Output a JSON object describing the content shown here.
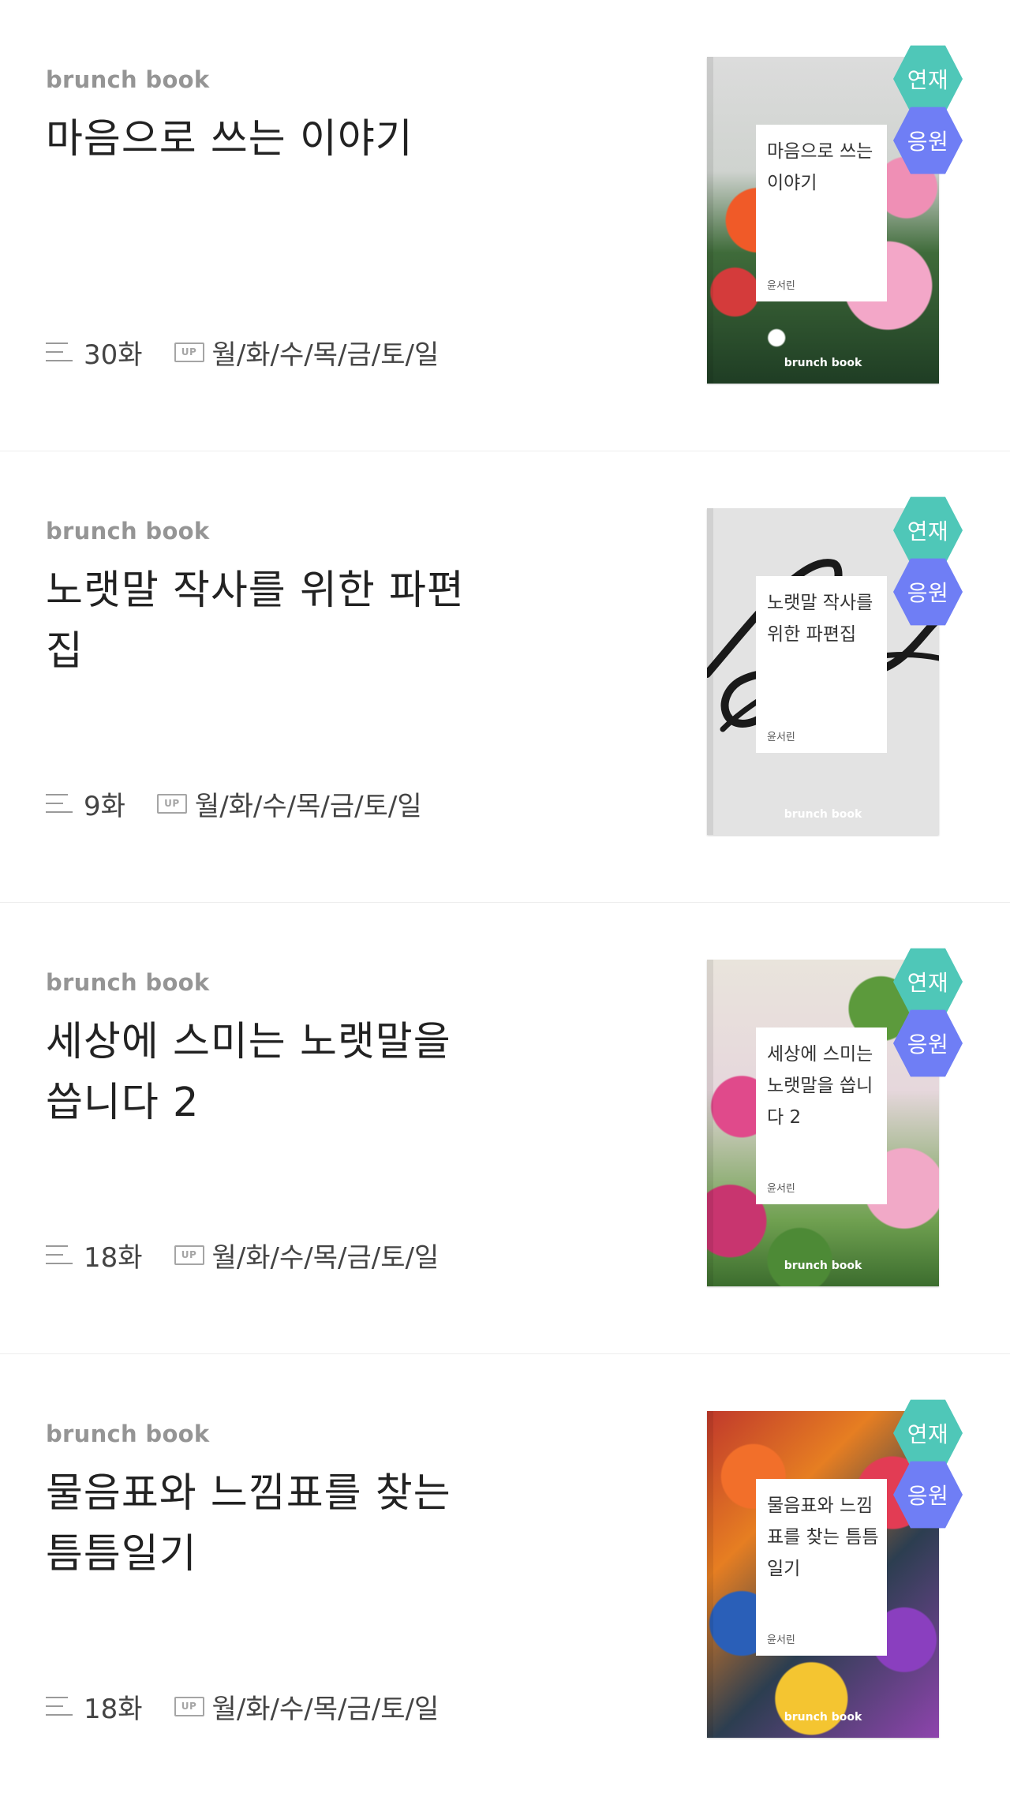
{
  "books": [
    {
      "eyebrow": "brunch book",
      "title": "마음으로 쓰는 이야기",
      "episodes": "30화",
      "up_badge": "UP",
      "schedule": "월/화/수/목/금/토/일",
      "cover": {
        "title": "마음으로 쓰는 이야기",
        "author": "윤서린",
        "brand": "brunch book"
      },
      "badges": {
        "serial": "연재",
        "support": "응원"
      }
    },
    {
      "eyebrow": "brunch book",
      "title": "노랫말 작사를 위한 파편집",
      "episodes": "9화",
      "up_badge": "UP",
      "schedule": "월/화/수/목/금/토/일",
      "cover": {
        "title": "노랫말 작사를 위한 파편집",
        "author": "윤서린",
        "brand": "brunch book"
      },
      "badges": {
        "serial": "연재",
        "support": "응원"
      }
    },
    {
      "eyebrow": "brunch book",
      "title": "세상에 스미는 노랫말을 씁니다 2",
      "episodes": "18화",
      "up_badge": "UP",
      "schedule": "월/화/수/목/금/토/일",
      "cover": {
        "title": "세상에 스미는 노랫말을 씁니다 2",
        "author": "윤서린",
        "brand": "brunch book"
      },
      "badges": {
        "serial": "연재",
        "support": "응원"
      }
    },
    {
      "eyebrow": "brunch book",
      "title": "물음표와 느낌표를 찾는 틈틈일기",
      "episodes": "18화",
      "up_badge": "UP",
      "schedule": "월/화/수/목/금/토/일",
      "cover": {
        "title": "물음표와 느낌표를 찾는 틈틈일기",
        "author": "윤서린",
        "brand": "brunch book"
      },
      "badges": {
        "serial": "연재",
        "support": "응원"
      }
    }
  ],
  "colors": {
    "serial_badge": "#4fc7b8",
    "support_badge": "#6f7ef5",
    "eyebrow": "#959595",
    "divider": "#eeeeee"
  },
  "icons": [
    "list-icon",
    "up-icon"
  ]
}
